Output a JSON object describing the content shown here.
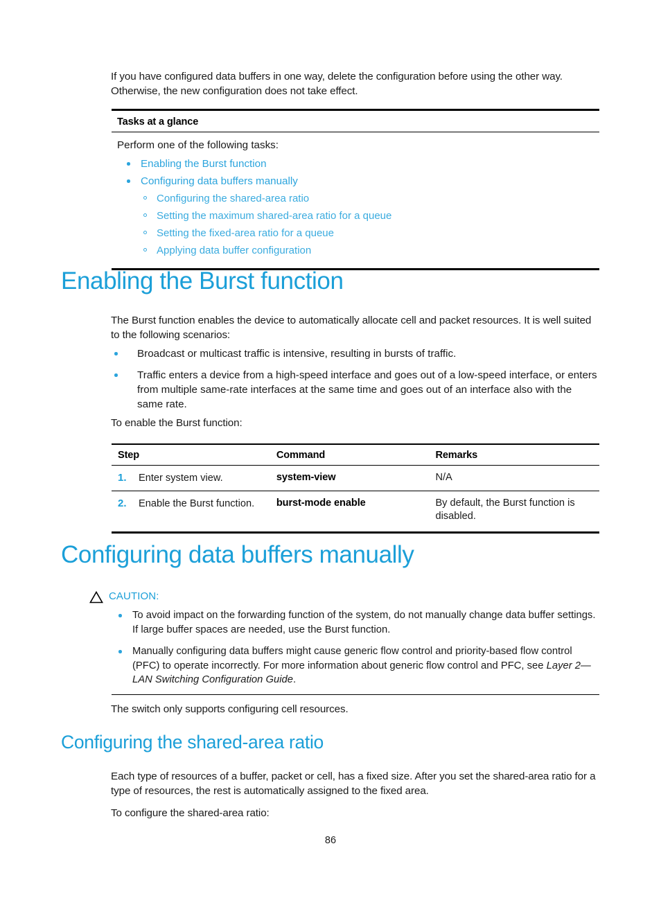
{
  "document": {
    "page_number": "86",
    "colors": {
      "heading_blue": "#1b9fd8",
      "link_blue": "#2ba4dd",
      "sublink_blue": "#3aabdf",
      "text_black": "#1a1a1a"
    }
  },
  "intro": {
    "paragraph": "If you have configured data buffers in one way, delete the configuration before using the other way. Otherwise, the new configuration does not take effect."
  },
  "tasks_box": {
    "header": "Tasks at a glance",
    "intro": "Perform one of the following tasks:",
    "items": [
      {
        "level": 1,
        "label": "Enabling the Burst function"
      },
      {
        "level": 1,
        "label": "Configuring data buffers manually"
      },
      {
        "level": 2,
        "label": "Configuring the shared-area ratio"
      },
      {
        "level": 2,
        "label": "Setting the maximum shared-area ratio for a queue"
      },
      {
        "level": 2,
        "label": "Setting the fixed-area ratio for a queue"
      },
      {
        "level": 2,
        "label": "Applying data buffer configuration"
      }
    ]
  },
  "section_burst": {
    "heading": "Enabling the Burst function",
    "intro": "The Burst function enables the device to automatically allocate cell and packet resources. It is well suited to the following scenarios:",
    "scenarios": [
      "Broadcast or multicast traffic is intensive, resulting in bursts of traffic.",
      "Traffic enters a device from a high-speed interface and goes out of a low-speed interface, or enters from multiple same-rate interfaces at the same time and goes out of an interface also with the same rate."
    ],
    "lead_in": "To enable the Burst function:",
    "table": {
      "headers": [
        "Step",
        "Command",
        "Remarks"
      ],
      "rows": [
        {
          "number": "1.",
          "step": "Enter system view.",
          "command": "system-view",
          "remarks": "N/A"
        },
        {
          "number": "2.",
          "step": "Enable the Burst function.",
          "command": "burst-mode enable",
          "remarks": "By default, the Burst function is disabled."
        }
      ]
    }
  },
  "section_buffers": {
    "heading": "Configuring data buffers manually",
    "caution": {
      "icon": "caution-triangle-icon",
      "label": "CAUTION:",
      "items": [
        {
          "text_before": "To avoid impact on the forwarding function of the system, do not manually change data buffer settings. If large buffer spaces are needed, use the Burst function.",
          "italic": "",
          "text_after": ""
        },
        {
          "text_before": "Manually configuring data buffers might cause generic flow control and priority-based flow control (PFC) to operate incorrectly. For more information about generic flow control and PFC, see ",
          "italic": "Layer 2—LAN Switching Configuration Guide",
          "text_after": "."
        }
      ]
    },
    "note": "The switch only supports configuring cell resources."
  },
  "section_shared_area": {
    "heading": "Configuring the shared-area ratio",
    "paragraph": "Each type of resources of a buffer, packet or cell, has a fixed size. After you set the shared-area ratio for a type of resources, the rest is automatically assigned to the fixed area.",
    "lead_in": "To configure the shared-area ratio:"
  }
}
